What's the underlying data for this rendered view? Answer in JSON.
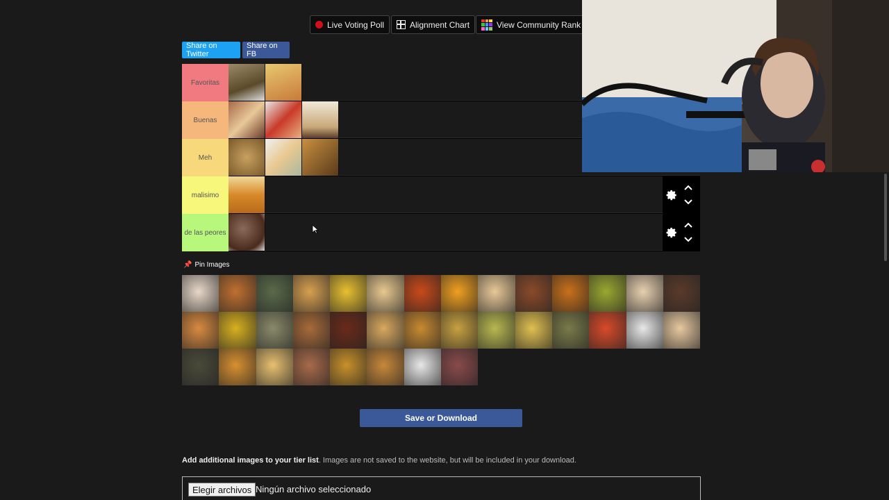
{
  "top_buttons": {
    "live_poll": "Live Voting Poll",
    "alignment": "Alignment Chart",
    "community": "View Community Rank"
  },
  "share": {
    "twitter": "Share on Twitter",
    "fb": "Share on FB"
  },
  "tiers": [
    {
      "label": "Favoritas",
      "color": "#f07a7f",
      "items": [
        "#7a6a4a",
        "#d8b060"
      ]
    },
    {
      "label": "Buenas",
      "color": "#f6b77c",
      "items": [
        "#8a5a3a",
        "#c83a28",
        "#e8d6b8"
      ]
    },
    {
      "label": "Meh",
      "color": "#f7d97c",
      "items": [
        "#a88050",
        "#e0d4b0",
        "#7a5a2a"
      ]
    },
    {
      "label": "malisimo",
      "color": "#f7f77c",
      "items": [
        "#d8902a"
      ]
    },
    {
      "label": "de las peores",
      "color": "#b7f77c",
      "items": [
        "#6a4a3a"
      ]
    }
  ],
  "pin_label": "Pin Images",
  "pool_items": [
    "#e8d8c8",
    "#c07030",
    "#5a6a4a",
    "#d8a050",
    "#e8c030",
    "#e8c890",
    "#c84a1a",
    "#f0a020",
    "#e8c898",
    "#8a4a2a",
    "#c8701a",
    "#9aa830",
    "#e8d0b0",
    "#5a3a2a",
    "#d88a40",
    "#d8b020",
    "#8a8a6a",
    "#a86a3a",
    "#6a2a1a",
    "#d8a860",
    "#c88a30",
    "#c8a040",
    "#b8b850",
    "#e0c050",
    "#7a7a4a",
    "#d84a2a",
    "#e8e8e8",
    "#e8c8a0",
    "#4a4a3a",
    "#d89030",
    "#e8c070",
    "#a86a4a",
    "#c8902a",
    "#c8883a",
    "#e8e8e8",
    "#8a4a4a"
  ],
  "save_label": "Save or Download",
  "add_images": {
    "bold": "Add additional images to your tier list",
    "text": ". Images are not saved to the website, but will be included in your download."
  },
  "file": {
    "button": "Elegir archivos",
    "status": "Ningún archivo seleccionado"
  },
  "colors": {
    "accent_blue": "#3b5998",
    "twitter_blue": "#1da1f2"
  }
}
